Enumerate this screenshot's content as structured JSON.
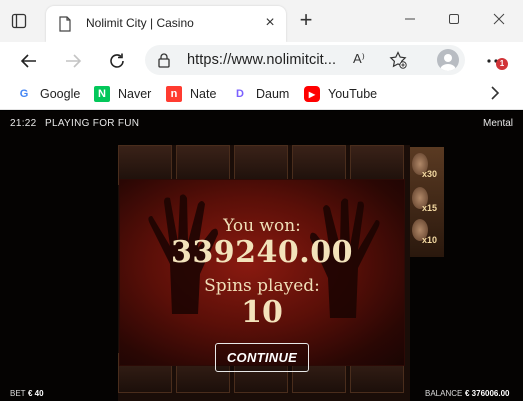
{
  "browser": {
    "tab_title": "Nolimit City | Casino",
    "url": "https://www.nolimitcit...",
    "read_aloud": "A⁾",
    "notifications_count": "1",
    "bookmarks": [
      {
        "label": "Google",
        "icon": "google-icon",
        "glyph": "G",
        "color": "#4285f4"
      },
      {
        "label": "Naver",
        "icon": "naver-icon",
        "glyph": "N",
        "color": "#03c75a"
      },
      {
        "label": "Nate",
        "icon": "nate-icon",
        "glyph": "n",
        "color": "#ff3b30"
      },
      {
        "label": "Daum",
        "icon": "daum-icon",
        "glyph": "D",
        "color": "#7b61ff"
      },
      {
        "label": "YouTube",
        "icon": "youtube-icon",
        "glyph": "▶",
        "color": "#ff0000"
      }
    ]
  },
  "game": {
    "time": "21:22",
    "mode": "PLAYING FOR FUN",
    "name": "Mental",
    "win_label": "You won:",
    "win_amount": "339240.00",
    "spins_label": "Spins played:",
    "spins_count": "10",
    "continue_label": "CONTINUE",
    "bet_label": "BET",
    "bet_value": "€ 40",
    "balance_label": "BALANCE",
    "balance_value": "€ 376006.00",
    "multipliers": [
      "x30",
      "x15",
      "x10"
    ]
  }
}
